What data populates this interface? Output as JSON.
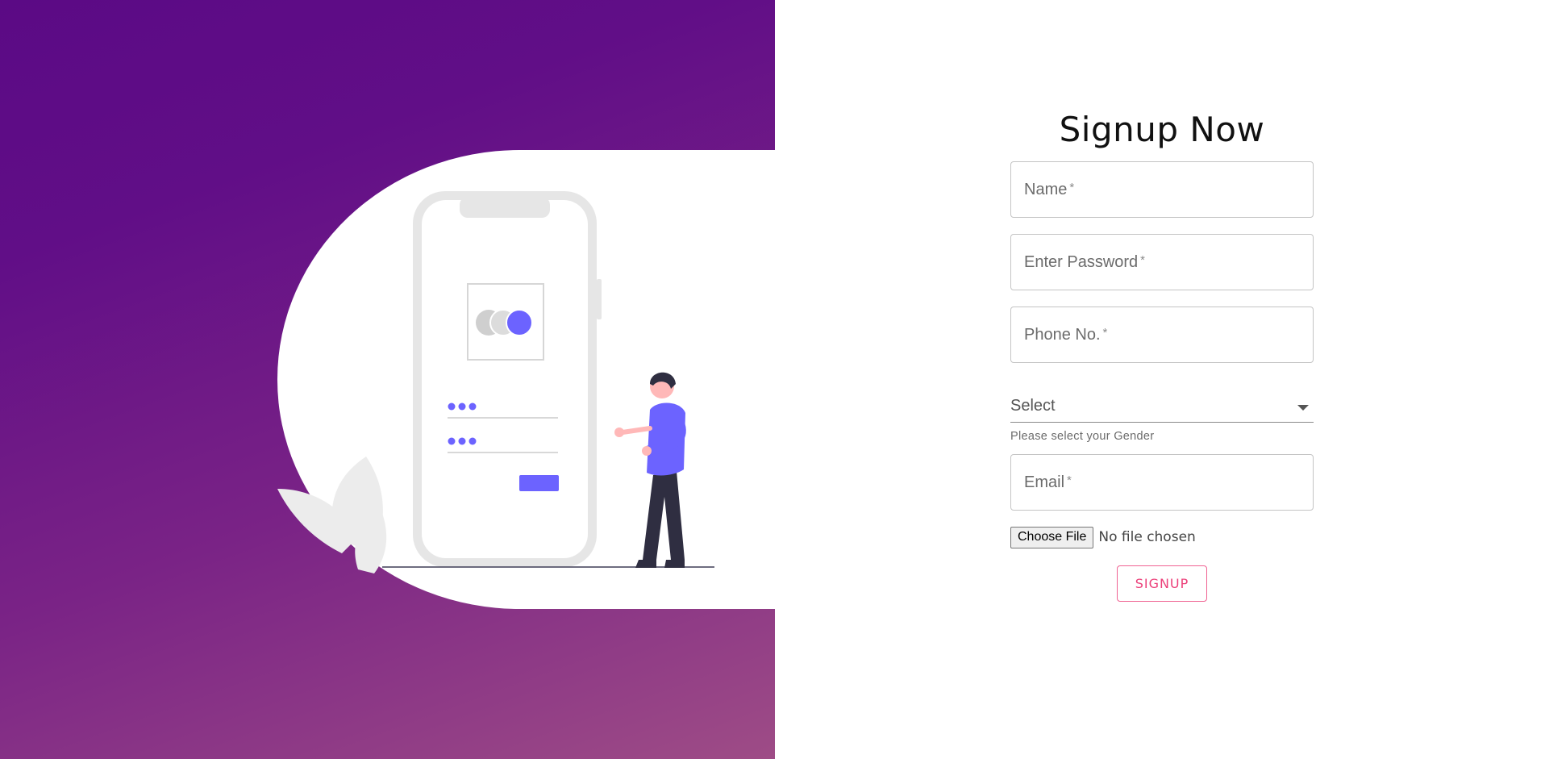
{
  "form": {
    "title": "Signup Now",
    "fields": {
      "name": {
        "label": "Name",
        "required_mark": "*"
      },
      "password": {
        "label": "Enter Password",
        "required_mark": "*"
      },
      "phone": {
        "label": "Phone No.",
        "required_mark": "*"
      },
      "email": {
        "label": "Email",
        "required_mark": "*"
      }
    },
    "gender": {
      "selected": "Select",
      "helper": "Please select your Gender"
    },
    "file": {
      "button_label": "Choose File",
      "status": "No file chosen"
    },
    "submit_label": "SIGNUP"
  },
  "colors": {
    "gradient_start": "#5b0a85",
    "gradient_end": "#9e4c86",
    "accent_pink": "#ec407a",
    "illustration_purple": "#6c63ff"
  }
}
